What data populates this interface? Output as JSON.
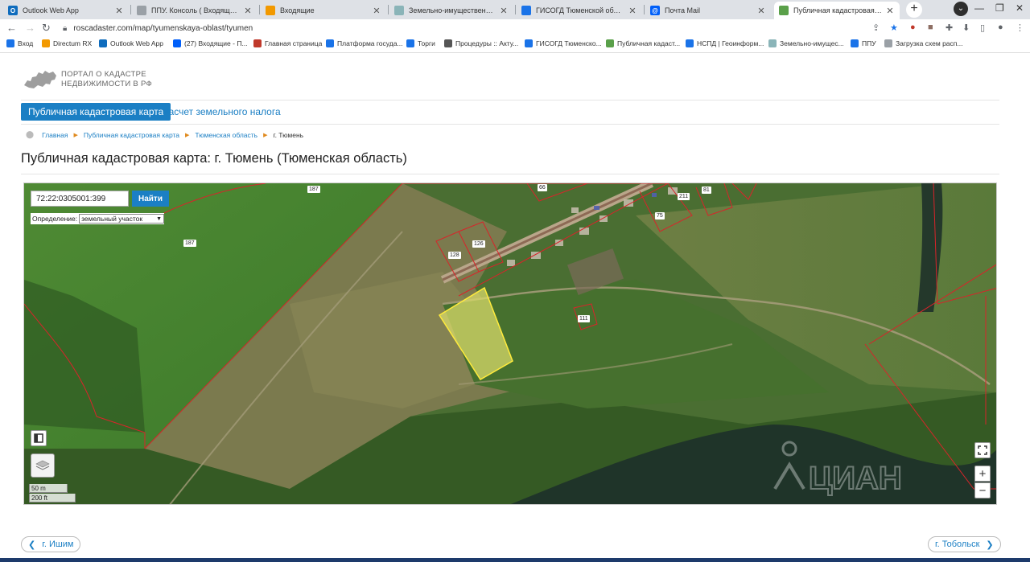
{
  "browser": {
    "tabs": [
      {
        "title": "Outlook Web App",
        "icon": "outlook-icon",
        "color": "#0f6cbd",
        "glyph": "O"
      },
      {
        "title": "ППУ. Консоль ( Входящие )",
        "icon": "document-icon",
        "color": "#9aa0a6",
        "glyph": ""
      },
      {
        "title": "Входящие",
        "icon": "mail-icon",
        "color": "#f29900",
        "glyph": ""
      },
      {
        "title": "Земельно-имущественный комп…",
        "icon": "page-icon",
        "color": "#8ab4b8",
        "glyph": ""
      },
      {
        "title": "ГИСОГД Тюменской области",
        "icon": "map-icon",
        "color": "#1a73e8",
        "glyph": ""
      },
      {
        "title": "Почта Mail",
        "icon": "mail-icon",
        "color": "#005ff9",
        "glyph": "@"
      },
      {
        "title": "Публичная кадастровая карта г.",
        "icon": "cadastre-icon",
        "color": "#5aa04a",
        "glyph": ""
      }
    ],
    "active_tab": 6,
    "url": "roscadaster.com/map/tyumenskaya-oblast/tyumen",
    "bookmarks": [
      {
        "label": "Вход",
        "color": "#1a73e8"
      },
      {
        "label": "Directum RX",
        "color": "#f29900"
      },
      {
        "label": "Outlook Web App",
        "color": "#0f6cbd"
      },
      {
        "label": "(27) Входящие - П...",
        "color": "#005ff9"
      },
      {
        "label": "Главная страница",
        "color": "#c0392b"
      },
      {
        "label": "Платформа госуда...",
        "color": "#1a73e8"
      },
      {
        "label": "Торги",
        "color": "#1a73e8"
      },
      {
        "label": "Процедуры :: Акту...",
        "color": "#555555"
      },
      {
        "label": "ГИСОГД Тюменско...",
        "color": "#1a73e8"
      },
      {
        "label": "Публичная кадаст...",
        "color": "#5aa04a"
      },
      {
        "label": "НСПД | Геоинформ...",
        "color": "#1a73e8"
      },
      {
        "label": "Земельно-имущес...",
        "color": "#8ab4b8"
      },
      {
        "label": "ППУ",
        "color": "#1a73e8"
      },
      {
        "label": "Загрузка схем расп...",
        "color": "#9aa0a6"
      }
    ]
  },
  "site": {
    "logo_line1": "ПОРТАЛ О КАДАСТРЕ",
    "logo_line2": "НЕДВИЖИМОСТИ В РФ",
    "nav": {
      "active": "Публичная кадастровая карта",
      "other": "Расчет земельного налога"
    },
    "breadcrumbs": [
      "Главная",
      "Публичная кадастровая карта",
      "Тюменская область",
      "г. Тюмень"
    ],
    "page_title": "Публичная кадастровая карта: г. Тюмень (Тюменская область)"
  },
  "map": {
    "search_value": "72:22:0305001:399",
    "search_button": "Найти",
    "definition_label": "Определение:",
    "definition_value": "земельный участок",
    "plot_labels": [
      "187",
      "187",
      "66",
      "211",
      "81",
      "75",
      "126",
      "128",
      "111"
    ],
    "scale_metric": "50 m",
    "scale_imperial": "200 ft",
    "zoom_in": "+",
    "zoom_out": "−",
    "watermark": "ЦИАН"
  },
  "pager": {
    "prev": "г. Ишим",
    "next": "г. Тобольск"
  }
}
